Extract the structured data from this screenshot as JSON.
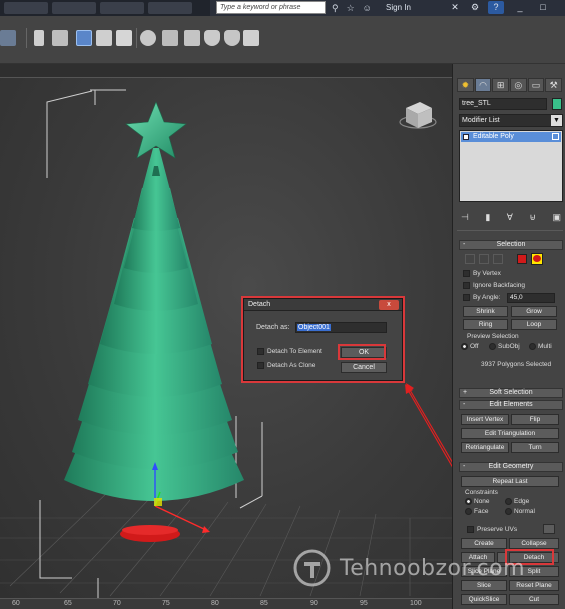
{
  "browser": {
    "search_placeholder": "Type a keyword or phrase",
    "signin": "Sign In",
    "help": "?",
    "minimize": "_",
    "maximize": "□"
  },
  "command_panel": {
    "object_name": "tree_STL",
    "object_color": "#39c08a",
    "modifier_list": "Modifier List",
    "stack_item": "Editable Poly"
  },
  "selection": {
    "title": "Selection",
    "by_vertex": "By Vertex",
    "ignore_backfacing": "Ignore Backfacing",
    "by_angle": "By Angle:",
    "angle_value": "45,0",
    "shrink": "Shrink",
    "grow": "Grow",
    "ring": "Ring",
    "loop": "Loop",
    "preview_title": "Preview Selection",
    "preview_off": "Off",
    "preview_subobj": "SubObj",
    "preview_multi": "Multi",
    "status": "3937 Polygons Selected"
  },
  "soft_selection": {
    "title": "Soft Selection"
  },
  "edit_elements": {
    "title": "Edit Elements",
    "insert_vertex": "Insert Vertex",
    "flip": "Flip",
    "edit_triangulation": "Edit Triangulation",
    "retriangulate": "Retriangulate",
    "turn": "Turn"
  },
  "edit_geometry": {
    "title": "Edit Geometry",
    "repeat_last": "Repeat Last",
    "constraints": "Constraints",
    "none": "None",
    "edge": "Edge",
    "face": "Face",
    "normal": "Normal",
    "preserve_uvs": "Preserve UVs",
    "create": "Create",
    "collapse": "Collapse",
    "attach": "Attach",
    "detach": "Detach",
    "slice_plane": "Slice Plane",
    "split": "Split",
    "slice": "Slice",
    "reset_plane": "Reset Plane",
    "quickslice": "QuickSlice",
    "cut": "Cut"
  },
  "dialog": {
    "title": "Detach",
    "close": "x",
    "detach_as_label": "Detach as:",
    "detach_as_value": "Object001",
    "to_element": "Detach To Element",
    "as_clone": "Detach As Clone",
    "ok": "OK",
    "cancel": "Cancel"
  },
  "ruler": {
    "ticks": [
      "60",
      "65",
      "70",
      "75",
      "80",
      "85",
      "90",
      "95",
      "100"
    ]
  },
  "watermark": {
    "text": "Tehnoobzor.com"
  }
}
